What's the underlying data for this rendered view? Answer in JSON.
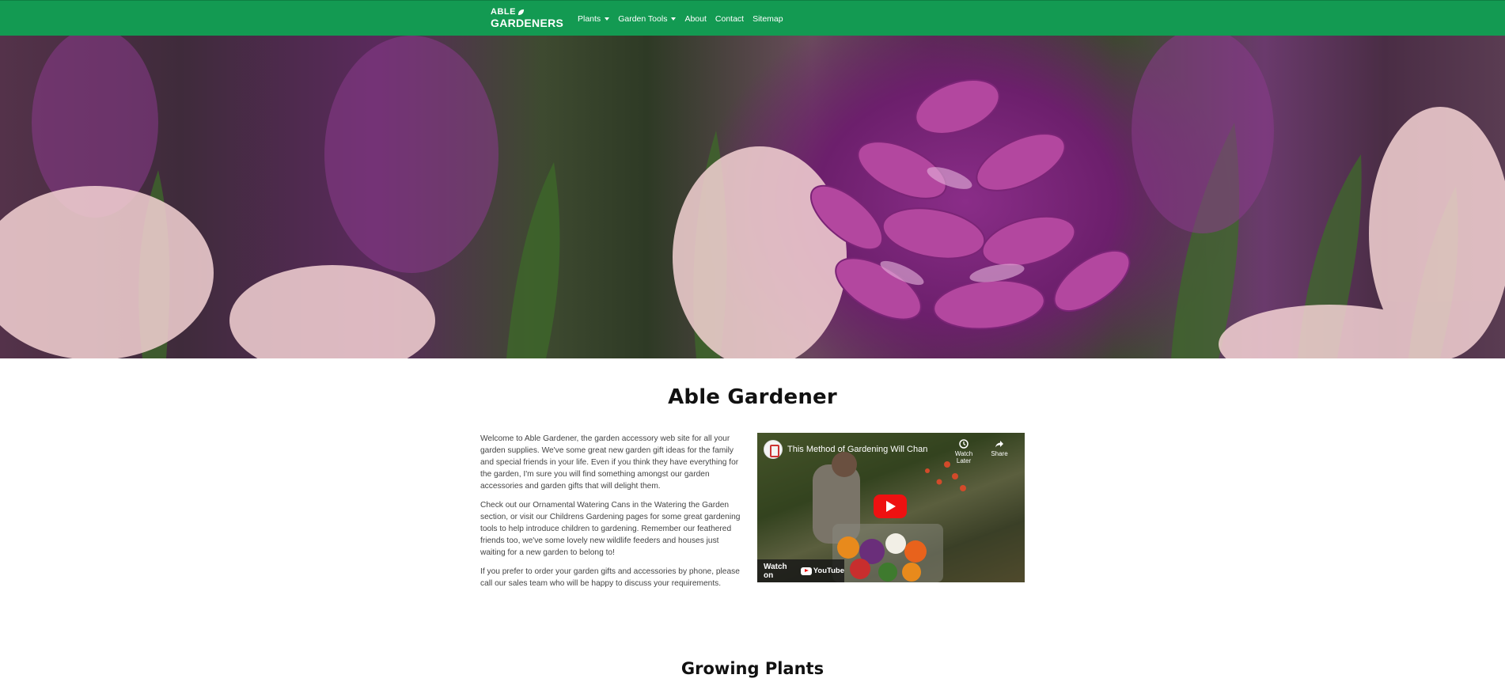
{
  "header": {
    "logo_line1": "ABLE",
    "logo_line2": "GARDENERS",
    "nav": [
      {
        "label": "Plants",
        "has_dropdown": true
      },
      {
        "label": "Garden Tools",
        "has_dropdown": true
      },
      {
        "label": "About",
        "has_dropdown": false
      },
      {
        "label": "Contact",
        "has_dropdown": false
      },
      {
        "label": "Sitemap",
        "has_dropdown": false
      }
    ]
  },
  "colors": {
    "header_bg": "#139a52",
    "text": "#444444",
    "heading": "#111111",
    "youtube_red": "#ee1111"
  },
  "main": {
    "title": "Able Gardener",
    "paragraphs": [
      "Welcome to Able Gardener, the garden accessory web site for all your garden supplies. We've some great new garden gift ideas for the family and special friends in your life. Even if you think they have everything for the garden, I'm sure you will find something amongst our garden accessories and garden gifts that will delight them.",
      "Check out our Ornamental Watering Cans in the Watering the Garden section, or visit our Childrens Gardening pages for some great gardening tools to help introduce children to gardening. Remember our feathered friends too, we've some lovely new wildlife feeders and houses just waiting for a new garden to belong to!",
      "If you prefer to order your garden gifts and accessories by phone, please call our sales team who will be happy to discuss your requirements."
    ],
    "video": {
      "title": "This Method of Gardening Will Chan",
      "watch_later": "Watch Later",
      "share": "Share",
      "watch_on": "Watch on",
      "youtube": "YouTube"
    },
    "section_title": "Growing Plants"
  }
}
